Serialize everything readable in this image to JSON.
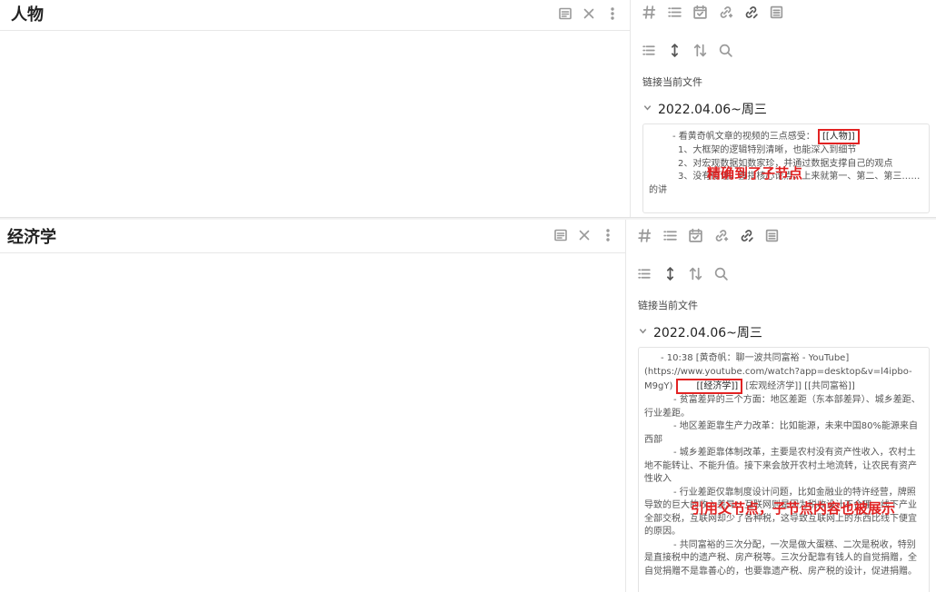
{
  "pane_top": {
    "title": "人物",
    "header_icons": [
      "reading-view-icon",
      "close-icon",
      "more-options-icon"
    ],
    "sidebar": {
      "tabs": [
        "tag-icon",
        "outline-icon",
        "calendar-icon",
        "backlinks-icon",
        "outgoing-links-icon",
        "file-list-icon"
      ],
      "tools": [
        "collapse-list-icon",
        "expand-icon",
        "sort-icon",
        "search-icon"
      ],
      "section_label": "链接当前文件",
      "group": {
        "date": "2022.04.06~周三",
        "lines": [
          {
            "pre": "- 看黄奇帆文章的视频的三点感受：",
            "link": "[[人物]]"
          },
          {
            "text": "1、大框架的逻辑特别清晰，也能深入到细节"
          },
          {
            "text": "2、对宏观数据如数家珍，并通过数据支撑自己的观点"
          },
          {
            "text": "3、没有废话，直指核心论点，上来就第一、第二、第三…… 的讲"
          }
        ]
      }
    },
    "annotation": "精确到了子节点"
  },
  "pane_bottom": {
    "title": "经济学",
    "header_icons": [
      "reading-view-icon",
      "close-icon",
      "more-options-icon"
    ],
    "sidebar": {
      "tabs": [
        "tag-icon",
        "outline-icon",
        "calendar-icon",
        "backlinks-icon",
        "outgoing-links-icon",
        "file-list-icon"
      ],
      "tools": [
        "collapse-list-icon",
        "expand-icon",
        "sort-icon",
        "search-icon"
      ],
      "section_label": "链接当前文件",
      "group": {
        "date": "2022.04.06~周三",
        "head_pre": "- 10:38 [黄奇帆：聊一波共同富裕 - YouTube](https://www.youtube.com/watch?app=desktop&v=l4ipbo-M9gY)",
        "head_link": "[[经济学]]",
        "head_post": "[宏观经济学]] [[共同富裕]]",
        "lines": [
          "- 贫富差异的三个方面：地区差距（东本部差异）、城乡差距、行业差距。",
          "- 地区差距靠生产力改革：比如能源，未来中国80%能源来自西部",
          "- 城乡差距靠体制改革，主要是农村没有资产性收入，农村土地不能转让、不能升值。接下来会放开农村土地流转，让农民有资产性收入",
          "- 行业差距仅靠制度设计问题，比如金融业的特许经营，牌照导致的巨大的收入差异；互联网则是因为税收设计不合理，线下产业全部交税，互联网却少了各种税，这导致互联网上的东西比线下便宜的原因。",
          "- 共同富裕的三次分配，一次是做大蛋糕、二次是税收，特别是直接税中的遗产税、房产税等。三次分配靠有钱人的自觉捐赠，全自觉捐赠不是靠善心的，也要靠遗产税、房产税的设计，促进捐赠。"
        ]
      }
    },
    "annotation": "引用父节点，子节点内容也被展示"
  }
}
